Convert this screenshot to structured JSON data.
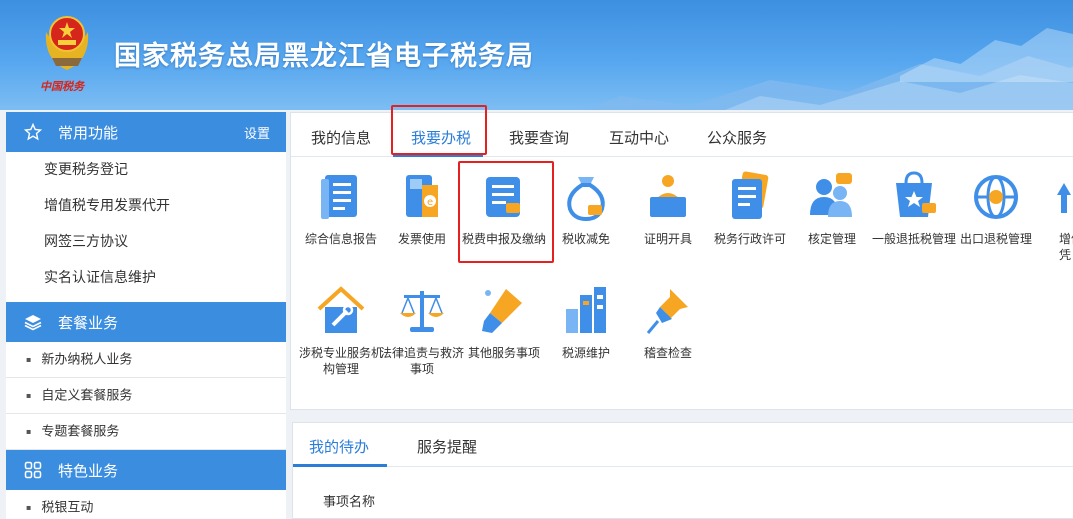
{
  "header": {
    "title": "国家税务总局黑龙江省电子税务局",
    "emblem_caption": "中国税务"
  },
  "sidebar": {
    "sections": [
      {
        "title": "常用功能",
        "icon": "star-icon",
        "extra": "设置",
        "items": [
          "变更税务登记",
          "增值税专用发票代开",
          "网签三方协议",
          "实名认证信息维护"
        ]
      },
      {
        "title": "套餐业务",
        "icon": "layers-icon",
        "items": [
          "新办纳税人业务",
          "自定义套餐服务",
          "专题套餐服务"
        ]
      },
      {
        "title": "特色业务",
        "icon": "grid-icon",
        "items": [
          "税银互动"
        ]
      }
    ]
  },
  "main": {
    "tabs": [
      "我的信息",
      "我要办税",
      "我要查询",
      "互动中心",
      "公众服务"
    ],
    "active_tab": "我要办税",
    "services_row1": [
      "综合信息报告",
      "发票使用",
      "税费申报及缴纳",
      "税收减免",
      "证明开具",
      "税务行政许可",
      "核定管理",
      "一般退抵税管理",
      "出口退税管理",
      "增值凭"
    ],
    "services_row2": [
      "涉税专业服务机构管理",
      "法律追责与救济事项",
      "其他服务事项",
      "税源维护",
      "稽查检查"
    ],
    "highlighted_service": "税费申报及缴纳"
  },
  "bottom": {
    "tabs": [
      "我的待办",
      "服务提醒"
    ],
    "active_tab": "我的待办",
    "column_header": "事项名称"
  },
  "colors": {
    "accent": "#2b7ed8",
    "sidebar_header": "#3b8de0",
    "highlight": "#e52020",
    "icon_blue": "#3f8fe8",
    "icon_orange": "#f6a623"
  }
}
